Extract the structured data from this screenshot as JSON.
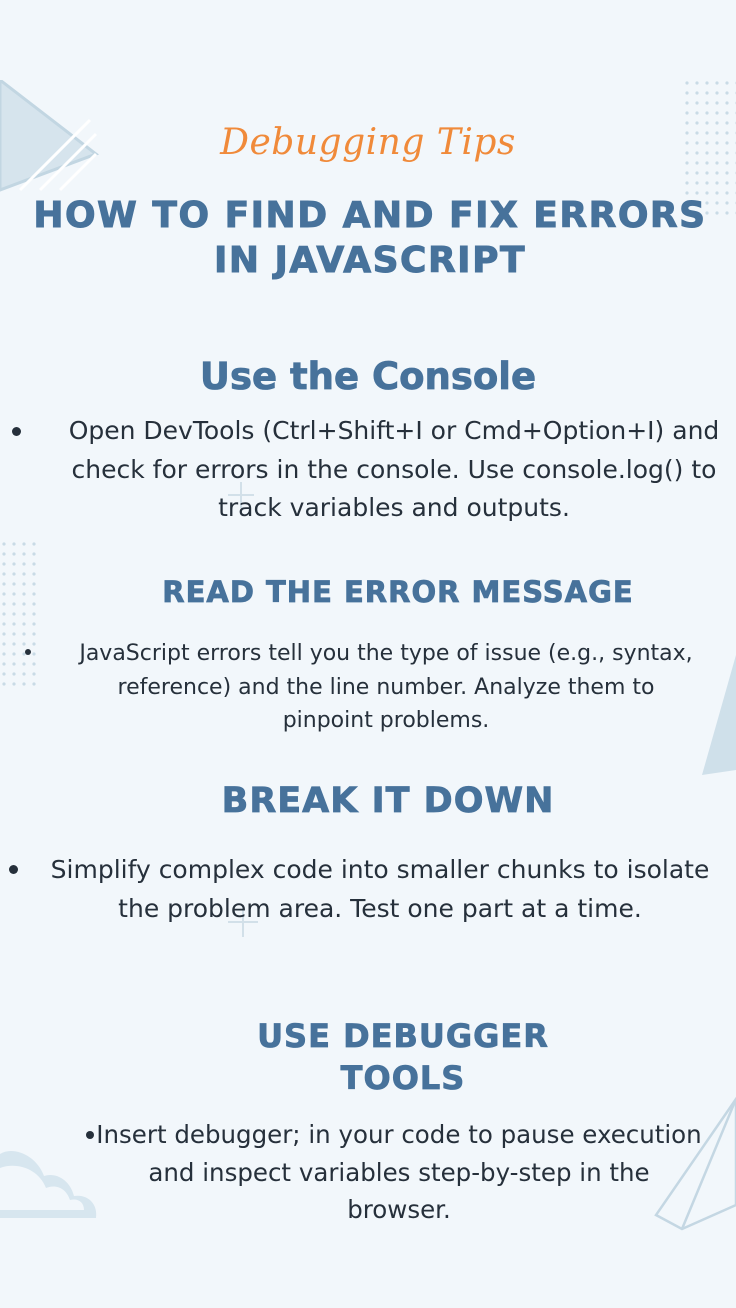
{
  "header": {
    "subtitle": "Debugging Tips",
    "title": "HOW TO FIND AND FIX ERRORS IN JAVASCRIPT"
  },
  "sections": [
    {
      "heading": "Use the Console",
      "text": "Open DevTools (Ctrl+Shift+I or Cmd+Option+I) and check for errors in the console. Use console.log() to track variables and outputs."
    },
    {
      "heading": "READ THE ERROR MESSAGE",
      "text": "JavaScript errors tell you the type of issue (e.g., syntax, reference) and the line number. Analyze them to pinpoint problems."
    },
    {
      "heading": "BREAK IT DOWN",
      "text": "Simplify complex code into smaller chunks to isolate the problem area. Test one part at a time."
    },
    {
      "heading": "USE DEBUGGER TOOLS",
      "text": "Insert debugger; in your code to pause execution and inspect variables step-by-step in the browser."
    }
  ],
  "colors": {
    "background": "#f2f7fb",
    "heading": "#47729b",
    "accent": "#f08a3a",
    "body_text": "#26303b",
    "decoration": "#c9dbe6"
  },
  "decorations": [
    "triangle-top-left",
    "dot-grid-top-right",
    "dot-grid-left",
    "triangle-right",
    "plus-signs",
    "cloud-bottom-left",
    "pyramid-bottom-right"
  ]
}
